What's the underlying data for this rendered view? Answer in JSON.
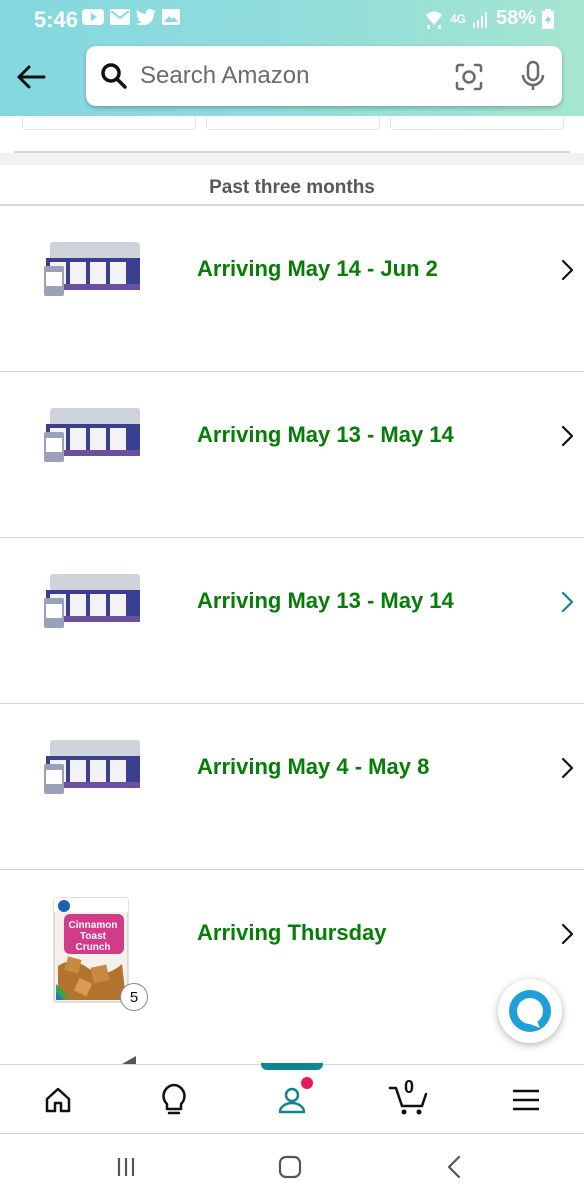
{
  "status_bar": {
    "time": "5:46",
    "network": "4G",
    "battery": "58%",
    "left_icons": [
      "youtube-icon",
      "mail-icon",
      "twitter-icon",
      "gallery-icon"
    ],
    "right_icons": [
      "wifi-icon",
      "signal-icon",
      "battery-icon"
    ]
  },
  "header": {
    "search_placeholder": "Search Amazon",
    "icons": [
      "back-arrow-icon",
      "search-icon",
      "camera-lens-icon",
      "mic-icon"
    ]
  },
  "orders": {
    "section_title": "Past three months",
    "items": [
      {
        "status": "Arriving May 14 - Jun 2",
        "product_icon": "canned-food-pack-icon"
      },
      {
        "status": "Arriving May 13 - May 14",
        "product_icon": "canned-food-pack-icon"
      },
      {
        "status": "Arriving May 13 - May 14",
        "product_icon": "canned-food-pack-icon"
      },
      {
        "status": "Arriving May 4 - May 8",
        "product_icon": "canned-food-pack-icon"
      },
      {
        "status": "Arriving Thursday",
        "product_icon": "cereal-box-icon",
        "quantity_badge": "5",
        "box_text": "Cinnamon Toast Crunch"
      }
    ]
  },
  "bottom_nav": {
    "items": [
      "home-icon",
      "lightbulb-icon",
      "account-icon",
      "cart-icon",
      "menu-icon"
    ],
    "cart_count": "0",
    "active_item": "account-icon"
  },
  "system_nav": {
    "items": [
      "recents-icon",
      "home-button-icon",
      "back-icon"
    ]
  },
  "colors": {
    "status_green": "#067d06",
    "accent_teal": "#108491",
    "notification_pink": "#e8185b",
    "header_start": "#83d8e0",
    "header_end": "#a5e6cf"
  }
}
